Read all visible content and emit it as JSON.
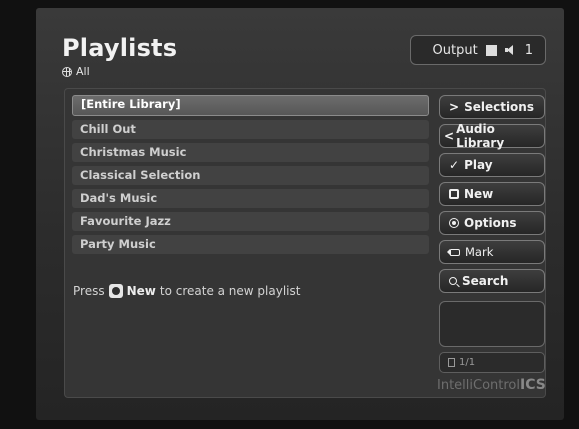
{
  "header": {
    "title": "Playlists",
    "subtitle": "All",
    "output_label": "Output",
    "output_number": "1"
  },
  "playlists": [
    {
      "label": "[Entire Library]"
    },
    {
      "label": "Chill Out"
    },
    {
      "label": "Christmas Music"
    },
    {
      "label": "Classical Selection"
    },
    {
      "label": "Dad's Music"
    },
    {
      "label": "Favourite Jazz"
    },
    {
      "label": "Party Music"
    }
  ],
  "hint": {
    "prefix": "Press",
    "key": "New",
    "suffix": "to create a new playlist"
  },
  "buttons": {
    "selections": "Selections",
    "audio_library": "Audio Library",
    "play": "Play",
    "new": "New",
    "options": "Options",
    "mark": "Mark",
    "search": "Search"
  },
  "pagination": {
    "label": "1/1"
  },
  "brand": {
    "name": "IntelliControl",
    "suffix": "ICS"
  }
}
